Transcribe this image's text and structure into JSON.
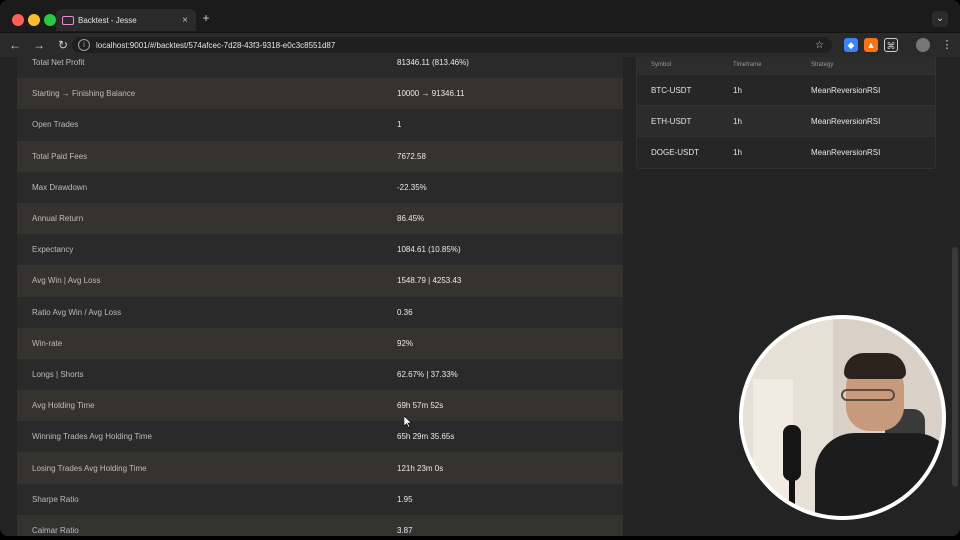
{
  "browser": {
    "tab_title": "Backtest - Jesse",
    "url": "localhost:9001/#/backtest/574afcec-7d28-43f3-9318-e0c3c8551d87"
  },
  "metrics": [
    {
      "label": "Total Net Profit",
      "value": "81346.11 (813.46%)"
    },
    {
      "label": "Starting → Finishing Balance",
      "value": "10000 → 91346.11"
    },
    {
      "label": "Open Trades",
      "value": "1"
    },
    {
      "label": "Total Paid Fees",
      "value": "7672.58"
    },
    {
      "label": "Max Drawdown",
      "value": "-22.35%"
    },
    {
      "label": "Annual Return",
      "value": "86.45%"
    },
    {
      "label": "Expectancy",
      "value": "1084.61 (10.85%)"
    },
    {
      "label": "Avg Win | Avg Loss",
      "value": "1548.79 | 4253.43"
    },
    {
      "label": "Ratio Avg Win / Avg Loss",
      "value": "0.36"
    },
    {
      "label": "Win-rate",
      "value": "92%"
    },
    {
      "label": "Longs | Shorts",
      "value": "62.67% | 37.33%"
    },
    {
      "label": "Avg Holding Time",
      "value": "69h 57m 52s"
    },
    {
      "label": "Winning Trades Avg Holding Time",
      "value": "65h 29m 35.65s"
    },
    {
      "label": "Losing Trades Avg Holding Time",
      "value": "121h 23m 0s"
    },
    {
      "label": "Sharpe Ratio",
      "value": "1.95"
    },
    {
      "label": "Calmar Ratio",
      "value": "3.87"
    }
  ],
  "routes": {
    "headers": [
      "Symbol",
      "Timeframe",
      "Strategy"
    ],
    "rows": [
      {
        "symbol": "BTC-USDT",
        "timeframe": "1h",
        "strategy": "MeanReversionRSI"
      },
      {
        "symbol": "ETH-USDT",
        "timeframe": "1h",
        "strategy": "MeanReversionRSI"
      },
      {
        "symbol": "DOGE-USDT",
        "timeframe": "1h",
        "strategy": "MeanReversionRSI"
      }
    ]
  },
  "icons": {
    "close": "close-icon",
    "new_tab": "plus-icon",
    "back": "arrow-left-icon",
    "forward": "arrow-right-icon",
    "reload": "reload-icon",
    "star": "star-icon"
  }
}
